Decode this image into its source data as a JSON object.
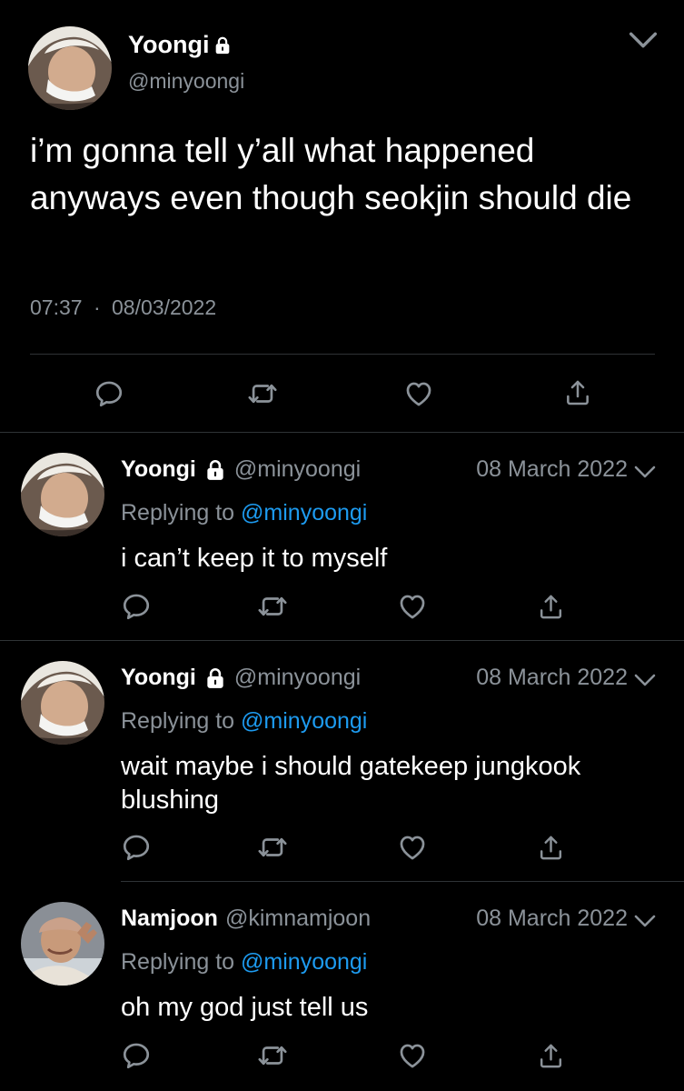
{
  "main_tweet": {
    "display_name": "Yoongi",
    "handle": "@minyoongi",
    "text": "i’m gonna tell y’all what happened anyways even though seokjin should die",
    "time": "07:37",
    "separator": "·",
    "date": "08/03/2022"
  },
  "replies": [
    {
      "display_name": "Yoongi",
      "handle": "@minyoongi",
      "date": "08 March 2022",
      "replying_prefix": "Replying to",
      "replying_handle": "@minyoongi",
      "text": "i can’t keep it to myself"
    },
    {
      "display_name": "Yoongi",
      "handle": "@minyoongi",
      "date": "08 March 2022",
      "replying_prefix": "Replying to",
      "replying_handle": "@minyoongi",
      "text": "wait maybe i should gatekeep jungkook blushing"
    },
    {
      "display_name": "Namjoon",
      "handle": "@kimnamjoon",
      "date": "08 March 2022",
      "replying_prefix": "Replying to",
      "replying_handle": "@minyoongi",
      "text": "oh my god just tell us"
    }
  ],
  "icons": {
    "reply": "reply-icon",
    "retweet": "retweet-icon",
    "like": "heart-icon",
    "share": "share-icon",
    "lock": "lock-icon",
    "more": "chevron-down-icon"
  },
  "colors": {
    "background": "#000000",
    "text": "#ffffff",
    "secondary": "#8b9299",
    "link": "#1d9bf0",
    "divider": "#2f3336"
  }
}
